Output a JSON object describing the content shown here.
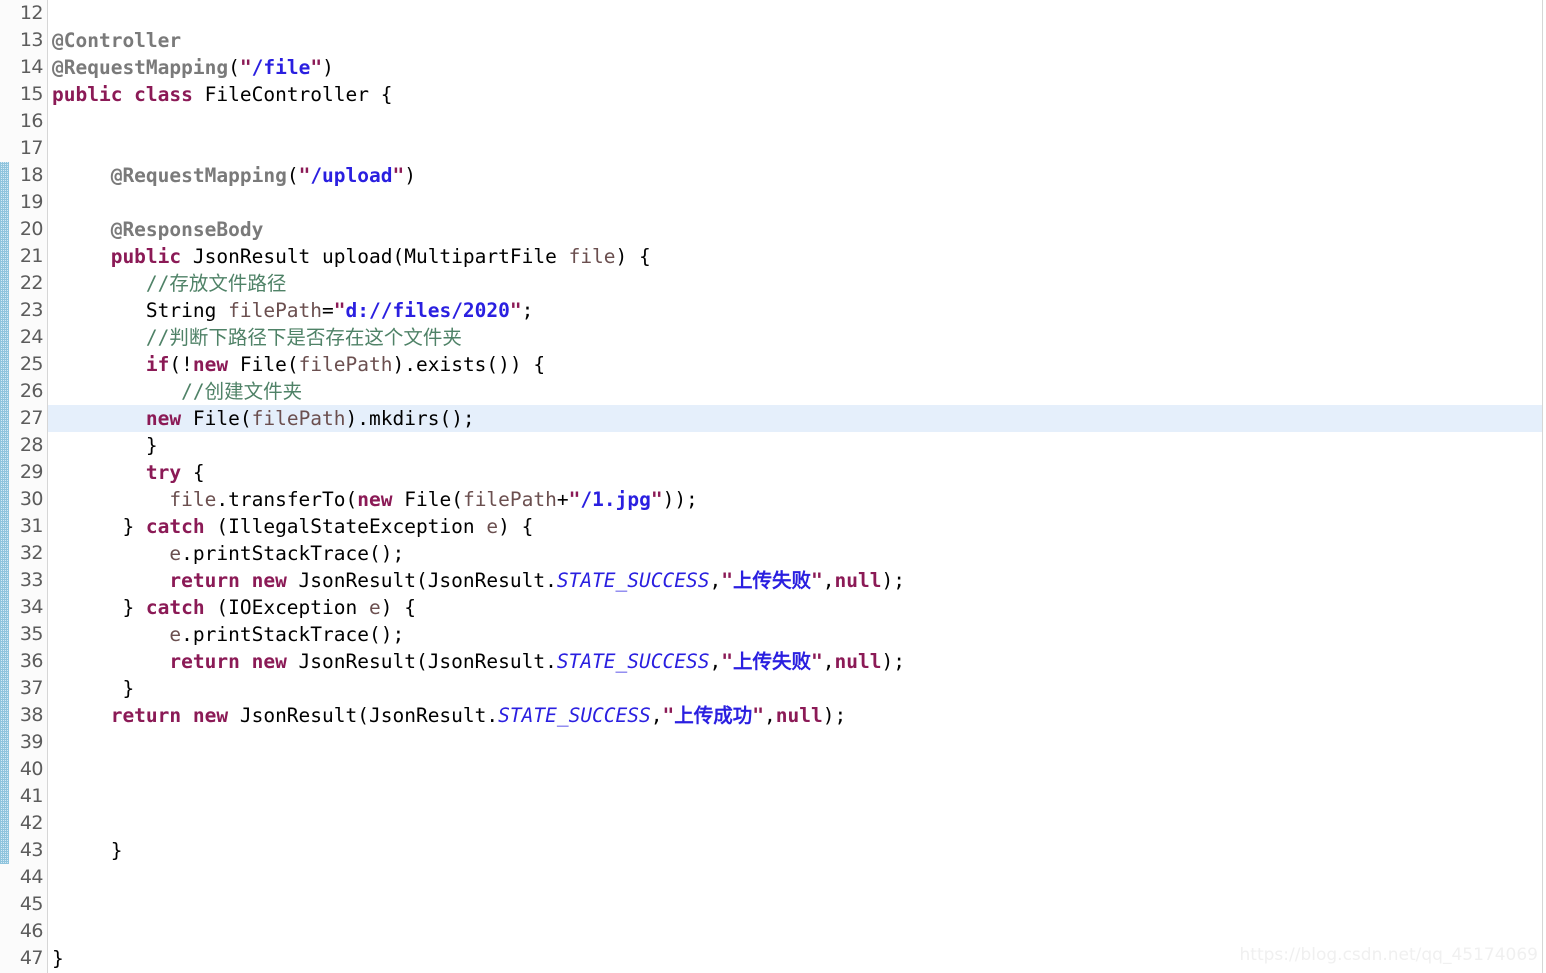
{
  "editor": {
    "first_line_number": 12,
    "last_line_number": 47,
    "current_line_number": 27,
    "fold_marker_line": 18,
    "fold_marker_icon": "collapse-minus-circle-icon",
    "change_stripe_start_line": 18,
    "change_stripe_end_line": 43,
    "colors": {
      "background": "#ffffff",
      "gutter_background": "#fbfbfb",
      "gutter_text": "#5c5c5c",
      "current_line_highlight": "#e5effb",
      "keyword": "#8b1a56",
      "annotation": "#7a7a7a",
      "string": "#2a1fe0",
      "quote": "#8b1a56",
      "comment": "#4f8267",
      "static_field": "#2a1fe0",
      "variable": "#6b4f4f",
      "change_stripe": "#8fc4dd"
    }
  },
  "watermark": {
    "text": "https://blog.csdn.net/qq_45174069"
  },
  "lines": [
    {
      "n": 12,
      "tokens": []
    },
    {
      "n": 13,
      "tokens": [
        {
          "t": "ann",
          "v": "@Controller"
        }
      ]
    },
    {
      "n": 14,
      "tokens": [
        {
          "t": "ann",
          "v": "@RequestMapping"
        },
        {
          "t": "plain",
          "v": "("
        },
        {
          "t": "quo",
          "v": "\""
        },
        {
          "t": "str",
          "v": "/file"
        },
        {
          "t": "quo",
          "v": "\""
        },
        {
          "t": "plain",
          "v": ")"
        }
      ]
    },
    {
      "n": 15,
      "tokens": [
        {
          "t": "kw",
          "v": "public class"
        },
        {
          "t": "plain",
          "v": " FileController {"
        }
      ]
    },
    {
      "n": 16,
      "tokens": []
    },
    {
      "n": 17,
      "tokens": []
    },
    {
      "n": 18,
      "tokens": [
        {
          "t": "plain",
          "v": "     "
        },
        {
          "t": "ann",
          "v": "@RequestMapping"
        },
        {
          "t": "plain",
          "v": "("
        },
        {
          "t": "quo",
          "v": "\""
        },
        {
          "t": "str",
          "v": "/upload"
        },
        {
          "t": "quo",
          "v": "\""
        },
        {
          "t": "plain",
          "v": ")"
        }
      ]
    },
    {
      "n": 19,
      "tokens": []
    },
    {
      "n": 20,
      "tokens": [
        {
          "t": "plain",
          "v": "     "
        },
        {
          "t": "ann",
          "v": "@ResponseBody"
        }
      ]
    },
    {
      "n": 21,
      "tokens": [
        {
          "t": "plain",
          "v": "     "
        },
        {
          "t": "kw",
          "v": "public"
        },
        {
          "t": "plain",
          "v": " JsonResult upload(MultipartFile "
        },
        {
          "t": "var",
          "v": "file"
        },
        {
          "t": "plain",
          "v": ") {"
        }
      ]
    },
    {
      "n": 22,
      "tokens": [
        {
          "t": "plain",
          "v": "        "
        },
        {
          "t": "cmt",
          "v": "//存放文件路径"
        }
      ]
    },
    {
      "n": 23,
      "tokens": [
        {
          "t": "plain",
          "v": "        String "
        },
        {
          "t": "var",
          "v": "filePath"
        },
        {
          "t": "plain",
          "v": "="
        },
        {
          "t": "quo",
          "v": "\""
        },
        {
          "t": "str",
          "v": "d://files/2020"
        },
        {
          "t": "quo",
          "v": "\""
        },
        {
          "t": "plain",
          "v": ";"
        }
      ]
    },
    {
      "n": 24,
      "tokens": [
        {
          "t": "plain",
          "v": "        "
        },
        {
          "t": "cmt",
          "v": "//判断下路径下是否存在这个文件夹"
        }
      ]
    },
    {
      "n": 25,
      "tokens": [
        {
          "t": "plain",
          "v": "        "
        },
        {
          "t": "kw",
          "v": "if"
        },
        {
          "t": "plain",
          "v": "(!"
        },
        {
          "t": "kw",
          "v": "new"
        },
        {
          "t": "plain",
          "v": " File("
        },
        {
          "t": "var",
          "v": "filePath"
        },
        {
          "t": "plain",
          "v": ").exists()) {"
        }
      ]
    },
    {
      "n": 26,
      "tokens": [
        {
          "t": "plain",
          "v": "           "
        },
        {
          "t": "cmt",
          "v": "//创建文件夹"
        }
      ]
    },
    {
      "n": 27,
      "tokens": [
        {
          "t": "plain",
          "v": "        "
        },
        {
          "t": "kw",
          "v": "new"
        },
        {
          "t": "plain",
          "v": " File("
        },
        {
          "t": "var",
          "v": "filePath"
        },
        {
          "t": "plain",
          "v": ").mkdirs();"
        }
      ]
    },
    {
      "n": 28,
      "tokens": [
        {
          "t": "plain",
          "v": "        }"
        }
      ]
    },
    {
      "n": 29,
      "tokens": [
        {
          "t": "plain",
          "v": "        "
        },
        {
          "t": "kw",
          "v": "try"
        },
        {
          "t": "plain",
          "v": " {"
        }
      ]
    },
    {
      "n": 30,
      "tokens": [
        {
          "t": "plain",
          "v": "          "
        },
        {
          "t": "var",
          "v": "file"
        },
        {
          "t": "plain",
          "v": ".transferTo("
        },
        {
          "t": "kw",
          "v": "new"
        },
        {
          "t": "plain",
          "v": " File("
        },
        {
          "t": "var",
          "v": "filePath"
        },
        {
          "t": "plain",
          "v": "+"
        },
        {
          "t": "quo",
          "v": "\""
        },
        {
          "t": "str",
          "v": "/1.jpg"
        },
        {
          "t": "quo",
          "v": "\""
        },
        {
          "t": "plain",
          "v": "));"
        }
      ]
    },
    {
      "n": 31,
      "tokens": [
        {
          "t": "plain",
          "v": "      } "
        },
        {
          "t": "kw",
          "v": "catch"
        },
        {
          "t": "plain",
          "v": " (IllegalStateException "
        },
        {
          "t": "var",
          "v": "e"
        },
        {
          "t": "plain",
          "v": ") {"
        }
      ]
    },
    {
      "n": 32,
      "tokens": [
        {
          "t": "plain",
          "v": "          "
        },
        {
          "t": "var",
          "v": "e"
        },
        {
          "t": "plain",
          "v": ".printStackTrace();"
        }
      ]
    },
    {
      "n": 33,
      "tokens": [
        {
          "t": "plain",
          "v": "          "
        },
        {
          "t": "kw",
          "v": "return new"
        },
        {
          "t": "plain",
          "v": " JsonResult(JsonResult."
        },
        {
          "t": "stat",
          "v": "STATE_SUCCESS"
        },
        {
          "t": "plain",
          "v": ","
        },
        {
          "t": "quo",
          "v": "\""
        },
        {
          "t": "str",
          "v": "上传失败"
        },
        {
          "t": "quo",
          "v": "\""
        },
        {
          "t": "plain",
          "v": ","
        },
        {
          "t": "kw",
          "v": "null"
        },
        {
          "t": "plain",
          "v": ");"
        }
      ]
    },
    {
      "n": 34,
      "tokens": [
        {
          "t": "plain",
          "v": "      } "
        },
        {
          "t": "kw",
          "v": "catch"
        },
        {
          "t": "plain",
          "v": " (IOException "
        },
        {
          "t": "var",
          "v": "e"
        },
        {
          "t": "plain",
          "v": ") {"
        }
      ]
    },
    {
      "n": 35,
      "tokens": [
        {
          "t": "plain",
          "v": "          "
        },
        {
          "t": "var",
          "v": "e"
        },
        {
          "t": "plain",
          "v": ".printStackTrace();"
        }
      ]
    },
    {
      "n": 36,
      "tokens": [
        {
          "t": "plain",
          "v": "          "
        },
        {
          "t": "kw",
          "v": "return new"
        },
        {
          "t": "plain",
          "v": " JsonResult(JsonResult."
        },
        {
          "t": "stat",
          "v": "STATE_SUCCESS"
        },
        {
          "t": "plain",
          "v": ","
        },
        {
          "t": "quo",
          "v": "\""
        },
        {
          "t": "str",
          "v": "上传失败"
        },
        {
          "t": "quo",
          "v": "\""
        },
        {
          "t": "plain",
          "v": ","
        },
        {
          "t": "kw",
          "v": "null"
        },
        {
          "t": "plain",
          "v": ");"
        }
      ]
    },
    {
      "n": 37,
      "tokens": [
        {
          "t": "plain",
          "v": "      }"
        }
      ]
    },
    {
      "n": 38,
      "tokens": [
        {
          "t": "plain",
          "v": "     "
        },
        {
          "t": "kw",
          "v": "return new"
        },
        {
          "t": "plain",
          "v": " JsonResult(JsonResult."
        },
        {
          "t": "stat",
          "v": "STATE_SUCCESS"
        },
        {
          "t": "plain",
          "v": ","
        },
        {
          "t": "quo",
          "v": "\""
        },
        {
          "t": "str",
          "v": "上传成功"
        },
        {
          "t": "quo",
          "v": "\""
        },
        {
          "t": "plain",
          "v": ","
        },
        {
          "t": "kw",
          "v": "null"
        },
        {
          "t": "plain",
          "v": ");"
        }
      ]
    },
    {
      "n": 39,
      "tokens": []
    },
    {
      "n": 40,
      "tokens": []
    },
    {
      "n": 41,
      "tokens": []
    },
    {
      "n": 42,
      "tokens": []
    },
    {
      "n": 43,
      "tokens": [
        {
          "t": "plain",
          "v": "     }"
        }
      ]
    },
    {
      "n": 44,
      "tokens": []
    },
    {
      "n": 45,
      "tokens": []
    },
    {
      "n": 46,
      "tokens": []
    },
    {
      "n": 47,
      "tokens": [
        {
          "t": "plain",
          "v": "}"
        }
      ]
    }
  ]
}
